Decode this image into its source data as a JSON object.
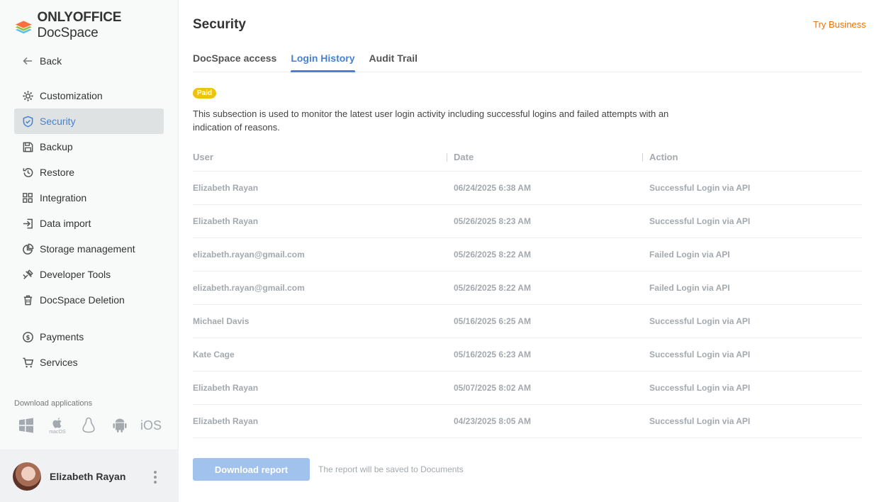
{
  "app": {
    "brand_bold": "ONLYOFFICE",
    "brand_light": " DocSpace",
    "try_business": "Try Business"
  },
  "sidebar": {
    "back_label": "Back",
    "items": [
      {
        "label": "Customization",
        "icon": "gear-icon"
      },
      {
        "label": "Security",
        "icon": "shield-icon",
        "active": true
      },
      {
        "label": "Backup",
        "icon": "floppy-icon"
      },
      {
        "label": "Restore",
        "icon": "restore-icon"
      },
      {
        "label": "Integration",
        "icon": "grid-icon"
      },
      {
        "label": "Data import",
        "icon": "import-icon"
      },
      {
        "label": "Storage management",
        "icon": "pie-icon"
      },
      {
        "label": "Developer Tools",
        "icon": "tools-icon"
      },
      {
        "label": "DocSpace Deletion",
        "icon": "trash-icon"
      }
    ],
    "items2": [
      {
        "label": "Payments",
        "icon": "dollar-icon"
      },
      {
        "label": "Services",
        "icon": "cart-icon"
      }
    ],
    "download_label": "Download applications",
    "apps": [
      "windows-icon",
      "macos-icon",
      "linux-icon",
      "android-icon",
      "ios-icon"
    ],
    "macos_label": "macOS",
    "ios_label": "iOS"
  },
  "profile": {
    "name": "Elizabeth Rayan"
  },
  "main": {
    "title": "Security",
    "tabs": [
      "DocSpace access",
      "Login History",
      "Audit Trail"
    ],
    "active_tab": 1,
    "badge": "Paid",
    "description": "This subsection is used to monitor the latest user login activity including successful logins and failed attempts with an indication of reasons.",
    "columns": [
      "User",
      "Date",
      "Action"
    ],
    "rows": [
      [
        "Elizabeth Rayan",
        "06/24/2025 6:38 AM",
        "Successful Login via API"
      ],
      [
        "Elizabeth Rayan",
        "05/26/2025 8:23 AM",
        "Successful Login via API"
      ],
      [
        "elizabeth.rayan@gmail.com",
        "05/26/2025 8:22 AM",
        "Failed Login via API"
      ],
      [
        "elizabeth.rayan@gmail.com",
        "05/26/2025 8:22 AM",
        "Failed Login via API"
      ],
      [
        "Michael Davis",
        "05/16/2025 6:25 AM",
        "Successful Login via API"
      ],
      [
        "Kate Cage",
        "05/16/2025 6:23 AM",
        "Successful Login via API"
      ],
      [
        "Elizabeth Rayan",
        "05/07/2025 8:02 AM",
        "Successful Login via API"
      ],
      [
        "Elizabeth Rayan",
        "04/23/2025 8:05 AM",
        "Successful Login via API"
      ]
    ],
    "download_button": "Download report",
    "download_hint": "The report will be saved to Documents"
  },
  "colors": {
    "accent": "#4781d1",
    "try_business": "#ed7309",
    "badge": "#edc409",
    "button_disabled": "#a1c2ed"
  }
}
